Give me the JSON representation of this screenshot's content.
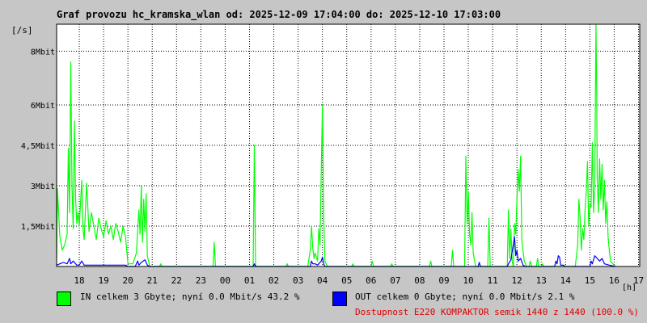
{
  "title": "Graf provozu hc_kramska_wlan od: 2025-12-09 17:04:00 do: 2025-12-10 17:03:00",
  "legend": {
    "in": {
      "label": "IN celkem 3 Gbyte; nyní   0.0 Mbit/s 43.2 %",
      "color": "#00ff00"
    },
    "out": {
      "label": "OUT celkem 0 Gbyte; nyní   0.0 Mbit/s 2.1 %",
      "color": "#0000ff"
    }
  },
  "availability": "Dostupnost E220 KOMPAKTOR semik 1440 z 1440 (100.0 %)",
  "chart_data": {
    "type": "area",
    "xlabel": "[h]",
    "ylabel": "[/s]",
    "ylim": [
      0,
      9
    ],
    "x_range": [
      17.067,
      17.05
    ],
    "y_ticks": [
      {
        "v": 1.5,
        "label": "1,5Mbit"
      },
      {
        "v": 3,
        "label": "3Mbit"
      },
      {
        "v": 4.5,
        "label": "4,5Mbit"
      },
      {
        "v": 6,
        "label": "6Mbit"
      },
      {
        "v": 8,
        "label": "8Mbit"
      }
    ],
    "x_ticks": [
      "18",
      "19",
      "20",
      "21",
      "22",
      "23",
      "00",
      "01",
      "02",
      "03",
      "04",
      "05",
      "06",
      "07",
      "08",
      "09",
      "10",
      "11",
      "12",
      "13",
      "14",
      "15",
      "16",
      "17"
    ],
    "grid": true,
    "series": [
      {
        "name": "IN",
        "color": "#00ff00",
        "points": [
          [
            17.07,
            0.3
          ],
          [
            17.1,
            2.9
          ],
          [
            17.2,
            1.1
          ],
          [
            17.3,
            0.6
          ],
          [
            17.4,
            0.8
          ],
          [
            17.5,
            1.2
          ],
          [
            17.55,
            4.4
          ],
          [
            17.6,
            2.0
          ],
          [
            17.65,
            7.6
          ],
          [
            17.7,
            3.0
          ],
          [
            17.75,
            1.4
          ],
          [
            17.8,
            5.4
          ],
          [
            17.85,
            2.5
          ],
          [
            17.9,
            1.6
          ],
          [
            17.95,
            2.0
          ],
          [
            18.0,
            1.5
          ],
          [
            18.1,
            3.2
          ],
          [
            18.15,
            1.4
          ],
          [
            18.2,
            1.0
          ],
          [
            18.3,
            3.1
          ],
          [
            18.4,
            1.3
          ],
          [
            18.5,
            2.0
          ],
          [
            18.6,
            1.5
          ],
          [
            18.7,
            1.0
          ],
          [
            18.8,
            1.8
          ],
          [
            18.9,
            1.4
          ],
          [
            19.0,
            1.1
          ],
          [
            19.1,
            1.7
          ],
          [
            19.2,
            1.2
          ],
          [
            19.3,
            1.5
          ],
          [
            19.4,
            1.0
          ],
          [
            19.5,
            1.6
          ],
          [
            19.6,
            1.3
          ],
          [
            19.7,
            0.9
          ],
          [
            19.8,
            1.5
          ],
          [
            19.9,
            1.1
          ],
          [
            19.95,
            0.6
          ],
          [
            20.0,
            0.1
          ],
          [
            20.2,
            0.1
          ],
          [
            20.35,
            0.5
          ],
          [
            20.45,
            2.1
          ],
          [
            20.5,
            1.2
          ],
          [
            20.55,
            3.0
          ],
          [
            20.6,
            0.9
          ],
          [
            20.65,
            2.5
          ],
          [
            20.7,
            1.3
          ],
          [
            20.75,
            2.7
          ],
          [
            20.8,
            0.4
          ],
          [
            20.9,
            0.0
          ],
          [
            21.0,
            0.0
          ],
          [
            21.3,
            0.0
          ],
          [
            21.35,
            0.1
          ],
          [
            21.4,
            0.0
          ],
          [
            23.5,
            0.0
          ],
          [
            23.55,
            0.9
          ],
          [
            23.6,
            0.0
          ],
          [
            25.15,
            0.0
          ],
          [
            25.2,
            4.5
          ],
          [
            25.25,
            0.0
          ],
          [
            26.5,
            0.0
          ],
          [
            26.55,
            0.1
          ],
          [
            26.6,
            0.0
          ],
          [
            27.4,
            0.0
          ],
          [
            27.5,
            0.6
          ],
          [
            27.55,
            1.5
          ],
          [
            27.6,
            0.7
          ],
          [
            27.65,
            0.3
          ],
          [
            27.7,
            0.5
          ],
          [
            27.8,
            0.2
          ],
          [
            27.85,
            1.4
          ],
          [
            27.9,
            0.8
          ],
          [
            27.95,
            3.5
          ],
          [
            28.0,
            6.0
          ],
          [
            28.05,
            2.0
          ],
          [
            28.1,
            0.2
          ],
          [
            28.2,
            0.0
          ],
          [
            29.2,
            0.0
          ],
          [
            29.25,
            0.1
          ],
          [
            29.3,
            0.0
          ],
          [
            30.0,
            0.0
          ],
          [
            30.05,
            0.2
          ],
          [
            30.1,
            0.0
          ],
          [
            30.8,
            0.0
          ],
          [
            30.85,
            0.1
          ],
          [
            30.9,
            0.0
          ],
          [
            32.4,
            0.0
          ],
          [
            32.45,
            0.2
          ],
          [
            32.5,
            0.0
          ],
          [
            33.3,
            0.0
          ],
          [
            33.35,
            0.6
          ],
          [
            33.4,
            0.0
          ],
          [
            33.85,
            0.0
          ],
          [
            33.9,
            4.1
          ],
          [
            33.95,
            1.6
          ],
          [
            34.0,
            2.8
          ],
          [
            34.05,
            1.2
          ],
          [
            34.1,
            0.8
          ],
          [
            34.15,
            2.0
          ],
          [
            34.2,
            0.5
          ],
          [
            34.3,
            0.0
          ],
          [
            34.8,
            0.0
          ],
          [
            34.85,
            1.8
          ],
          [
            34.9,
            0.0
          ],
          [
            35.6,
            0.0
          ],
          [
            35.65,
            2.1
          ],
          [
            35.7,
            0.3
          ],
          [
            35.75,
            1.4
          ],
          [
            35.8,
            0.2
          ],
          [
            35.85,
            0.0
          ],
          [
            35.9,
            1.6
          ],
          [
            35.95,
            1.2
          ],
          [
            36.0,
            2.5
          ],
          [
            36.05,
            3.6
          ],
          [
            36.1,
            2.8
          ],
          [
            36.15,
            4.1
          ],
          [
            36.2,
            1.0
          ],
          [
            36.3,
            0.2
          ],
          [
            36.4,
            0.0
          ],
          [
            36.5,
            0.0
          ],
          [
            36.55,
            0.2
          ],
          [
            36.6,
            0.0
          ],
          [
            36.8,
            0.0
          ],
          [
            36.85,
            0.3
          ],
          [
            36.9,
            0.0
          ],
          [
            37.0,
            0.0
          ],
          [
            37.05,
            0.1
          ],
          [
            37.1,
            0.0
          ],
          [
            38.4,
            0.0
          ],
          [
            38.5,
            0.8
          ],
          [
            38.55,
            2.5
          ],
          [
            38.6,
            1.8
          ],
          [
            38.65,
            0.6
          ],
          [
            38.7,
            1.4
          ],
          [
            38.75,
            1.0
          ],
          [
            38.8,
            2.1
          ],
          [
            38.85,
            2.8
          ],
          [
            38.9,
            3.9
          ],
          [
            38.95,
            1.5
          ],
          [
            39.0,
            2.3
          ],
          [
            39.05,
            2.2
          ],
          [
            39.1,
            4.6
          ],
          [
            39.15,
            2.0
          ],
          [
            39.2,
            3.0
          ],
          [
            39.25,
            9.0
          ],
          [
            39.28,
            6.5
          ],
          [
            39.3,
            3.4
          ],
          [
            39.35,
            2.0
          ],
          [
            39.4,
            4.0
          ],
          [
            39.45,
            2.5
          ],
          [
            39.5,
            3.8
          ],
          [
            39.55,
            2.1
          ],
          [
            39.6,
            3.2
          ],
          [
            39.65,
            1.6
          ],
          [
            39.7,
            2.4
          ],
          [
            39.75,
            1.1
          ],
          [
            39.8,
            0.6
          ],
          [
            39.85,
            0.2
          ],
          [
            40.05,
            0.0
          ]
        ]
      },
      {
        "name": "OUT",
        "color": "#0000ff",
        "points": [
          [
            17.07,
            0.05
          ],
          [
            17.2,
            0.1
          ],
          [
            17.35,
            0.15
          ],
          [
            17.5,
            0.1
          ],
          [
            17.6,
            0.3
          ],
          [
            17.65,
            0.1
          ],
          [
            17.75,
            0.2
          ],
          [
            17.9,
            0.05
          ],
          [
            18.0,
            0.05
          ],
          [
            18.1,
            0.2
          ],
          [
            18.2,
            0.05
          ],
          [
            18.5,
            0.05
          ],
          [
            19.0,
            0.05
          ],
          [
            19.5,
            0.05
          ],
          [
            19.9,
            0.05
          ],
          [
            20.0,
            0.0
          ],
          [
            20.3,
            0.0
          ],
          [
            20.4,
            0.2
          ],
          [
            20.45,
            0.05
          ],
          [
            20.55,
            0.15
          ],
          [
            20.7,
            0.25
          ],
          [
            20.8,
            0.05
          ],
          [
            20.9,
            0.0
          ],
          [
            25.15,
            0.0
          ],
          [
            25.2,
            0.1
          ],
          [
            25.25,
            0.0
          ],
          [
            27.5,
            0.0
          ],
          [
            27.55,
            0.2
          ],
          [
            27.6,
            0.1
          ],
          [
            27.7,
            0.1
          ],
          [
            27.8,
            0.05
          ],
          [
            27.95,
            0.2
          ],
          [
            28.0,
            0.35
          ],
          [
            28.05,
            0.1
          ],
          [
            28.1,
            0.0
          ],
          [
            34.4,
            0.0
          ],
          [
            34.45,
            0.15
          ],
          [
            34.5,
            0.0
          ],
          [
            35.6,
            0.0
          ],
          [
            35.65,
            0.1
          ],
          [
            35.75,
            0.25
          ],
          [
            35.9,
            1.1
          ],
          [
            35.95,
            0.4
          ],
          [
            36.0,
            0.6
          ],
          [
            36.05,
            0.2
          ],
          [
            36.15,
            0.3
          ],
          [
            36.25,
            0.05
          ],
          [
            36.35,
            0.0
          ],
          [
            37.55,
            0.0
          ],
          [
            37.6,
            0.2
          ],
          [
            37.65,
            0.1
          ],
          [
            37.7,
            0.4
          ],
          [
            37.75,
            0.35
          ],
          [
            37.8,
            0.05
          ],
          [
            37.9,
            0.05
          ],
          [
            38.0,
            0.0
          ],
          [
            39.0,
            0.0
          ],
          [
            39.05,
            0.2
          ],
          [
            39.1,
            0.1
          ],
          [
            39.2,
            0.4
          ],
          [
            39.3,
            0.3
          ],
          [
            39.4,
            0.2
          ],
          [
            39.5,
            0.3
          ],
          [
            39.6,
            0.1
          ],
          [
            39.8,
            0.05
          ],
          [
            40.05,
            0.0
          ]
        ]
      }
    ]
  }
}
